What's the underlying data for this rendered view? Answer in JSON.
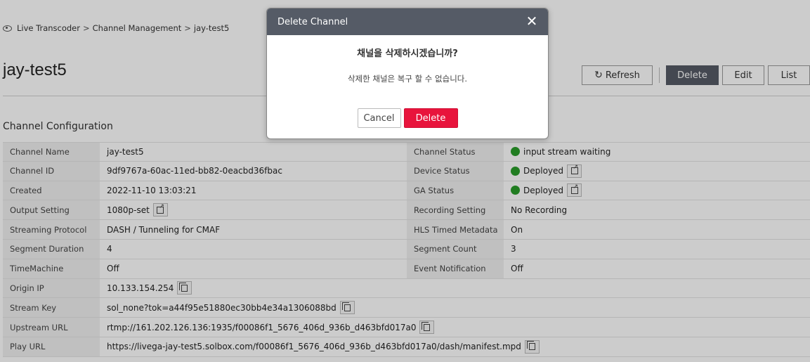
{
  "breadcrumb": {
    "icon": "eye-icon",
    "items": [
      "Live Transcoder",
      "Channel Management",
      "jay-test5"
    ],
    "separator": ">"
  },
  "page": {
    "title": "jay-test5"
  },
  "toolbar": {
    "refresh_label": "Refresh",
    "delete_label": "Delete",
    "edit_label": "Edit",
    "list_label": "List"
  },
  "section": {
    "title": "Channel Configuration"
  },
  "config": {
    "rows": [
      {
        "l1": "Channel Name",
        "v1": "jay-test5",
        "l2": "Channel Status",
        "v2": "input stream waiting"
      },
      {
        "l1": "Channel ID",
        "v1": "9df9767a-60ac-11ed-bb82-0eacbd36fbac",
        "l2": "Device Status",
        "v2": "Deployed"
      },
      {
        "l1": "Created",
        "v1": "2022-11-10 13:03:21",
        "l2": "GA Status",
        "v2": "Deployed"
      },
      {
        "l1": "Output Setting",
        "v1": "1080p-set",
        "l2": "Recording Setting",
        "v2": "No Recording"
      },
      {
        "l1": "Streaming Protocol",
        "v1": "DASH / Tunneling for CMAF",
        "l2": "HLS Timed Metadata",
        "v2": "On"
      },
      {
        "l1": "Segment Duration",
        "v1": "4",
        "l2": "Segment Count",
        "v2": "3"
      },
      {
        "l1": "TimeMachine",
        "v1": "Off",
        "l2": "Event Notification",
        "v2": "Off"
      },
      {
        "l1": "Origin IP",
        "v1": "10.133.154.254"
      },
      {
        "l1": "Stream Key",
        "v1": "sol_none?tok=a44f95e51880ec30bb4e34a1306088bd"
      },
      {
        "l1": "Upstream URL",
        "v1": "rtmp://161.202.126.136:1935/f00086f1_5676_406d_936b_d463bfd017a0"
      },
      {
        "l1": "Play URL",
        "v1": "https://livega-jay-test5.solbox.com/f00086f1_5676_406d_936b_d463bfd017a0/dash/manifest.mpd"
      }
    ],
    "status_color": "#2a9d2a"
  },
  "modal": {
    "title": "Delete Channel",
    "question": "채널을 삭제하시겠습니까?",
    "message": "삭제한 채널은 복구 할 수 없습니다.",
    "cancel_label": "Cancel",
    "confirm_label": "Delete",
    "confirm_color": "#e8143c",
    "header_color": "#555b66"
  }
}
